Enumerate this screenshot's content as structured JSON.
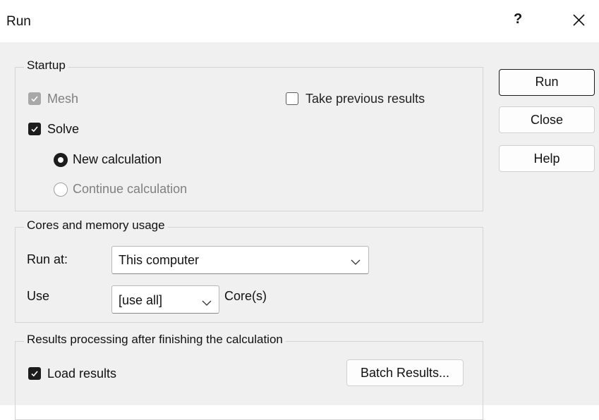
{
  "window": {
    "title": "Run",
    "help_glyph": "?",
    "close_icon": "close-icon"
  },
  "startup": {
    "legend": "Startup",
    "mesh_label": "Mesh",
    "mesh_checked": true,
    "mesh_enabled": false,
    "take_previous_label": "Take previous results",
    "take_previous_checked": false,
    "solve_label": "Solve",
    "solve_checked": true,
    "new_calc_label": "New calculation",
    "new_calc_selected": true,
    "continue_calc_label": "Continue calculation",
    "continue_calc_enabled": false
  },
  "cores": {
    "legend": "Cores and memory usage",
    "run_at_label": "Run at:",
    "run_at_value": "This computer",
    "use_label": "Use",
    "use_value": "[use all]",
    "cores_suffix": "Core(s)"
  },
  "results": {
    "legend": "Results processing after finishing the calculation",
    "load_results_label": "Load results",
    "load_results_checked": true,
    "batch_results_label": "Batch Results..."
  },
  "buttons": {
    "run": "Run",
    "close": "Close",
    "help": "Help"
  },
  "colors": {
    "dialog_bg": "#f0f0f0",
    "titlebar_bg": "#ffffff",
    "checked_fill": "#1c1c1c",
    "disabled_text": "#808080"
  }
}
